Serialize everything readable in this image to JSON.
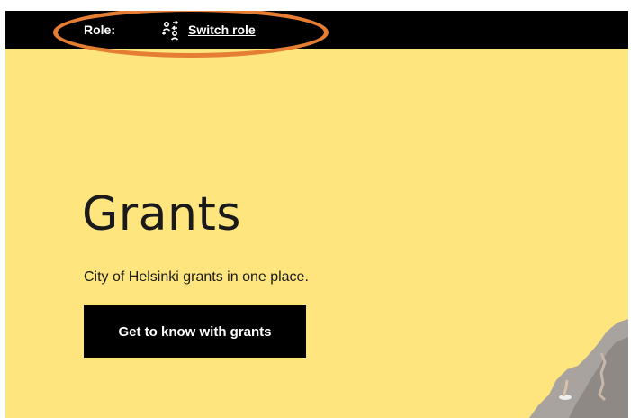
{
  "topbar": {
    "role_label": "Role:",
    "switch_role_label": "Switch role",
    "switch_icon": "switch-role-icon"
  },
  "hero": {
    "title": "Grants",
    "subtitle": "City of Helsinki grants in one place.",
    "cta_label": "Get to know with grants",
    "image": "hero-illustration"
  },
  "colors": {
    "background": "#fee57e",
    "topbar": "#000000",
    "cta": "#000000",
    "highlight": "#e57d33"
  }
}
